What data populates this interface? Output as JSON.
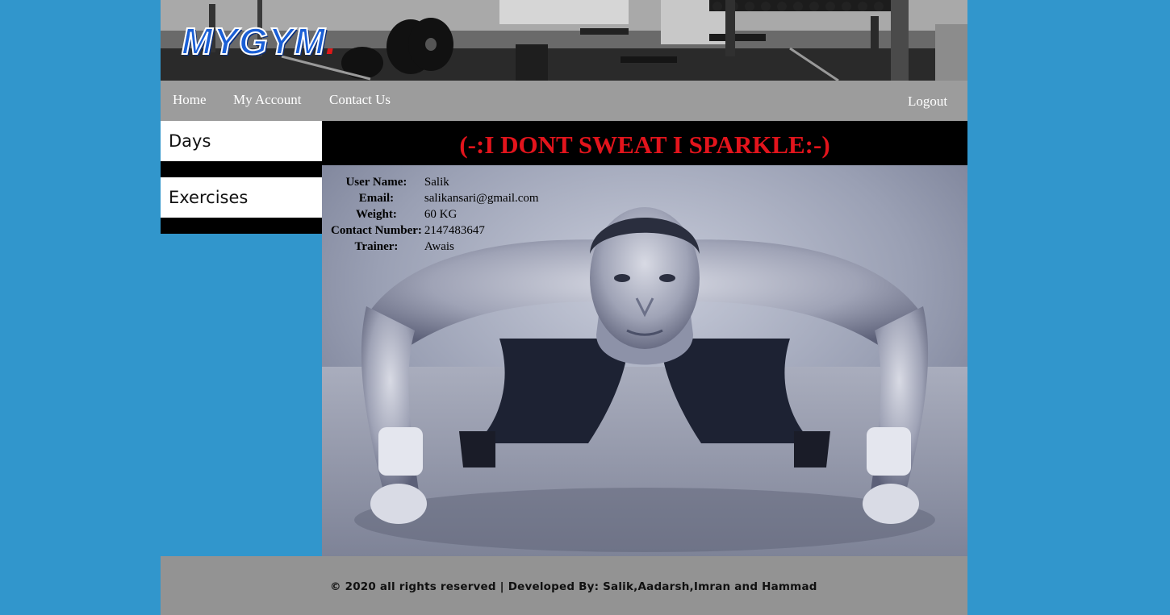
{
  "header": {
    "logo_text": "MYGYM",
    "logo_dot": ".",
    "banner_image": "gym-equipment-photo"
  },
  "nav": {
    "home": "Home",
    "my_account": "My Account",
    "contact_us": "Contact Us",
    "logout": "Logout"
  },
  "sidebar": {
    "items": [
      {
        "label": "Days"
      },
      {
        "label": "Exercises"
      }
    ]
  },
  "main": {
    "headline": "(-:I DONT SWEAT I SPARKLE:-)",
    "hero_image": "man-doing-pushups-photo",
    "profile": {
      "user_name_label": "User Name:",
      "user_name": "Salik",
      "email_label": "Email:",
      "email": "salikansari@gmail.com",
      "weight_label": "Weight:",
      "weight": "60 KG",
      "contact_label": "Contact Number:",
      "contact": "2147483647",
      "trainer_label": "Trainer:",
      "trainer": "Awais"
    }
  },
  "footer": {
    "text": "© 2020 all rights reserved | Developed By: Salik,Aadarsh,Imran and Hammad"
  },
  "colors": {
    "page_background": "#3196cc",
    "navbar": "#9c9c9c",
    "footer": "#939393",
    "headline": "#e3141c",
    "logo_blue": "#1a5fd6",
    "logo_dot": "#e01818"
  }
}
